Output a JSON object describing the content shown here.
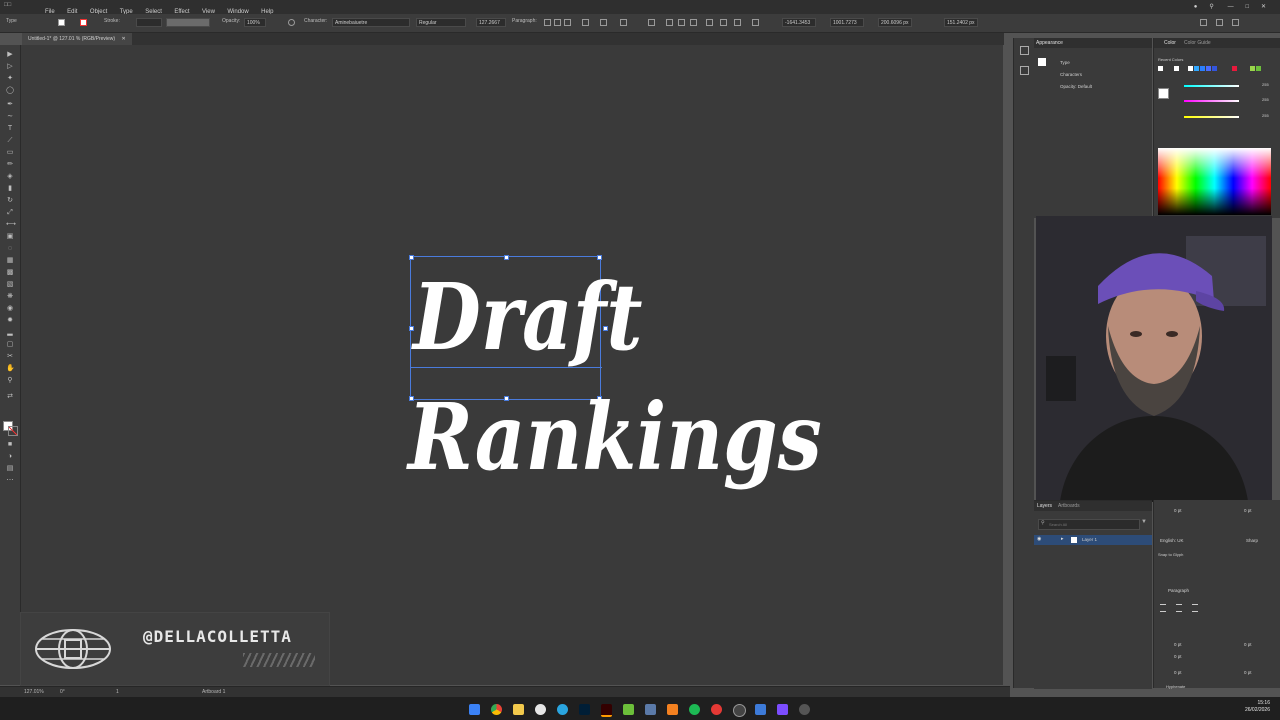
{
  "menubar": {
    "items": [
      "File",
      "Edit",
      "Object",
      "Type",
      "Select",
      "Effect",
      "View",
      "Window",
      "Help"
    ]
  },
  "controlbar": {
    "type_label": "Type",
    "stroke_label": "Stroke:",
    "opacity_label": "Opacity:",
    "opacity_value": "100%",
    "character_label": "Character:",
    "font_name": "Aminebaiuetre",
    "font_style": "Regular",
    "font_size": "127.2667",
    "paragraph_label": "Paragraph:",
    "x_value": "-1641.3453",
    "y_value": "1001.7273",
    "w_value": "200.6096 px",
    "h_value": "151.2402 px"
  },
  "document": {
    "tab_title": "Untitled-1* @ 127.01 % (RGB/Preview)"
  },
  "artwork": {
    "line1": "Draft",
    "line2": "Rankings"
  },
  "overlay": {
    "handle": "@DELLACOLLETTA"
  },
  "appearance_panel": {
    "tab": "Appearance",
    "type_label": "Type",
    "characters_label": "Characters",
    "opacity_row": "Opacity: Default"
  },
  "color_panel": {
    "tab_color": "Color",
    "tab_guide": "Color Guide",
    "recent_colors_label": "Recent Colors",
    "r_value": "255",
    "g_value": "255",
    "b_value": "255"
  },
  "layers_panel": {
    "tab_layers": "Layers",
    "tab_artboards": "Artboards",
    "search_placeholder": "Search All",
    "layer_name": "Layer 1"
  },
  "char_props": {
    "size_value": "0 pt",
    "language": "English: UK",
    "antialias": "Sharp",
    "snap_label": "Snap to Glyph",
    "paragraph_label": "Paragraph",
    "indent_value": "0 pt",
    "hyphenate_label": "Hyphenate"
  },
  "statusbar": {
    "zoom": "127.01%",
    "rotation": "0°",
    "artboard_num": "1",
    "artboard_name": "Artboard 1"
  },
  "taskbar": {
    "time": "15:16",
    "date": "26/02/2026"
  }
}
